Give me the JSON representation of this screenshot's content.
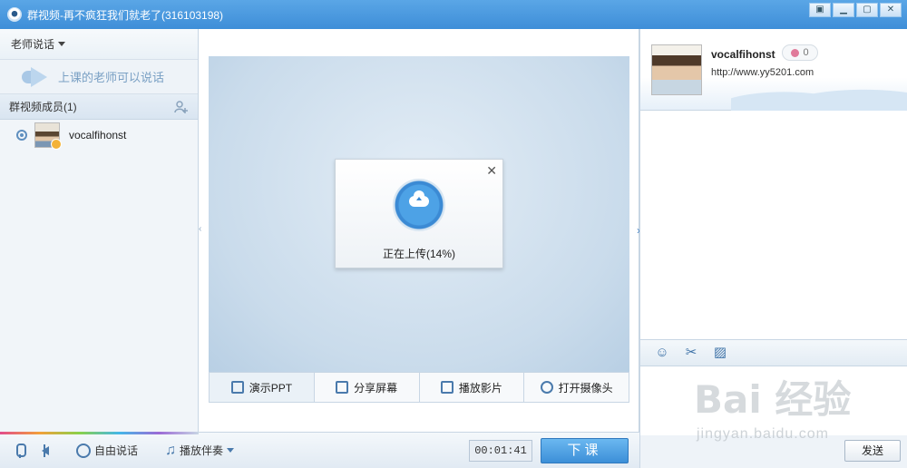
{
  "window": {
    "title": "群视频-再不疯狂我们就老了(316103198)"
  },
  "left": {
    "speak_mode": "老师说话",
    "speak_tip": "上课的老师可以说话",
    "members_header": "群视频成员(1)",
    "members": [
      {
        "name": "vocalfihonst"
      }
    ]
  },
  "stage": {
    "upload_text": "正在上传(14%)",
    "upload_progress_percent": 14,
    "tabs": [
      {
        "label": "演示PPT"
      },
      {
        "label": "分享屏幕"
      },
      {
        "label": "播放影片"
      },
      {
        "label": "打开摄像头"
      }
    ]
  },
  "bottombar": {
    "free_speak": "自由说话",
    "accompany": "播放伴奏",
    "timer": "00:01:41",
    "end_class": "下课"
  },
  "right": {
    "profile_name": "vocalfihonst",
    "rose_count": "0",
    "profile_url": "http://www.yy5201.com",
    "send_label": "发送"
  },
  "watermark": {
    "brand": "Bai  经验",
    "url": "jingyan.baidu.com"
  }
}
